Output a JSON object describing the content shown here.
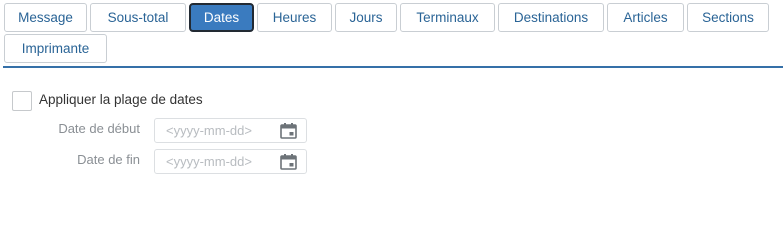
{
  "tabs": [
    {
      "label": "Message",
      "active": false
    },
    {
      "label": "Sous-total",
      "active": false
    },
    {
      "label": "Dates",
      "active": true
    },
    {
      "label": "Heures",
      "active": false
    },
    {
      "label": "Jours",
      "active": false
    },
    {
      "label": "Terminaux",
      "active": false
    },
    {
      "label": "Destinations",
      "active": false
    },
    {
      "label": "Articles",
      "active": false
    },
    {
      "label": "Sections",
      "active": false
    },
    {
      "label": "Imprimante",
      "active": false
    }
  ],
  "date_range": {
    "checkbox_label": "Appliquer la plage de dates",
    "checked": false,
    "start": {
      "label": "Date de début",
      "placeholder": "<yyyy-mm-dd>",
      "icon": "calendar-icon"
    },
    "end": {
      "label": "Date de fin",
      "placeholder": "<yyyy-mm-dd>",
      "icon": "calendar-icon"
    }
  },
  "colors": {
    "accent": "#3a7bbf",
    "tab_text": "#2a6496",
    "divider": "#3570a8"
  }
}
